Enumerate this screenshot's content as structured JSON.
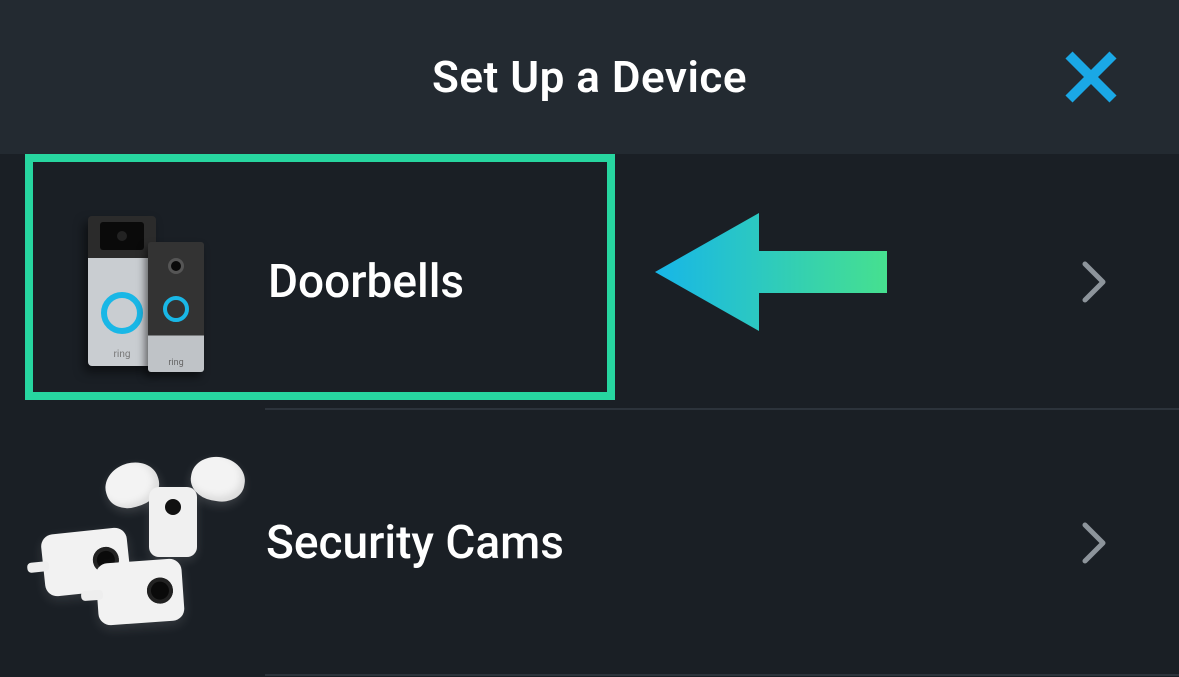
{
  "header": {
    "title": "Set Up a Device"
  },
  "list": {
    "items": [
      {
        "label": "Doorbells",
        "highlighted": true,
        "icon": "doorbell-devices-icon"
      },
      {
        "label": "Security Cams",
        "highlighted": false,
        "icon": "security-cam-devices-icon"
      }
    ]
  },
  "colors": {
    "close_icon": "#1aa8e6",
    "highlight_border": "#27d6a0",
    "arrow_gradient_from": "#17b6e8",
    "arrow_gradient_to": "#46e08f"
  }
}
